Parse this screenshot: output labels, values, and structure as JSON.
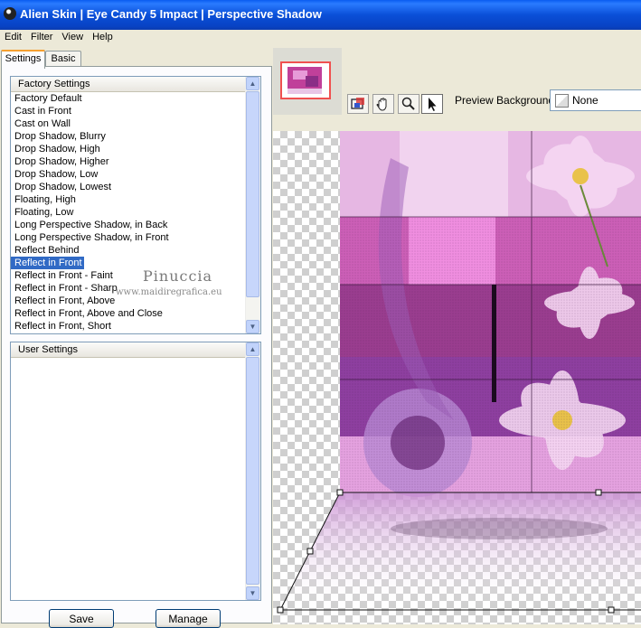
{
  "window": {
    "title": "Alien Skin | Eye Candy 5 Impact | Perspective Shadow"
  },
  "menu": [
    "Edit",
    "Filter",
    "View",
    "Help"
  ],
  "tabs": [
    {
      "label": "Settings",
      "active": true
    },
    {
      "label": "Basic",
      "active": false
    }
  ],
  "factory_settings": {
    "header": "Factory Settings",
    "items": [
      "Factory Default",
      "Cast in Front",
      "Cast on Wall",
      "Drop Shadow, Blurry",
      "Drop Shadow, High",
      "Drop Shadow, Higher",
      "Drop Shadow, Low",
      "Drop Shadow, Lowest",
      "Floating, High",
      "Floating, Low",
      "Long Perspective Shadow, in Back",
      "Long Perspective Shadow, in Front",
      "Reflect Behind",
      "Reflect in Front",
      "Reflect in Front - Faint",
      "Reflect in Front - Sharp",
      "Reflect in Front, Above",
      "Reflect in Front, Above and Close",
      "Reflect in Front, Short"
    ],
    "selected": "Reflect in Front"
  },
  "user_settings": {
    "header": "User Settings",
    "items": []
  },
  "watermark": {
    "name": "Pinuccia",
    "url": "www.maidiregrafica.eu"
  },
  "buttons": {
    "save": "Save",
    "manage": "Manage"
  },
  "toolbar": {
    "tools": [
      "navigate-icon",
      "hand-icon",
      "zoom-icon",
      "pointer-icon"
    ],
    "active_tool": "pointer-icon"
  },
  "preview_background": {
    "label": "Preview Background:",
    "value": "None"
  },
  "colors": {
    "titlebar": "#0a4fd8",
    "selection": "#316ac5",
    "accent_pink": "#d94fb5"
  }
}
